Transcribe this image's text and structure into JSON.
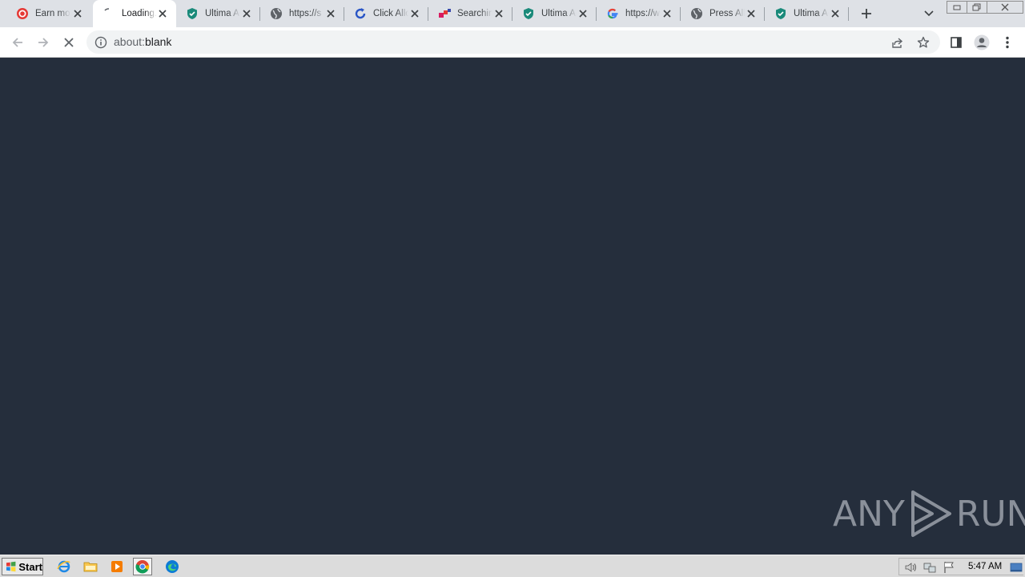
{
  "tabs": [
    {
      "title": "Earn money",
      "favicon": "red-target-icon"
    },
    {
      "title": "Loading...",
      "favicon": "loading-spinner-icon",
      "active": true
    },
    {
      "title": "Ultima Ad",
      "favicon": "shield-icon"
    },
    {
      "title": "https://s",
      "favicon": "globe-icon"
    },
    {
      "title": "Click Allow",
      "favicon": "refresh-icon"
    },
    {
      "title": "Searching",
      "favicon": "squares-icon"
    },
    {
      "title": "Ultima Ad",
      "favicon": "shield-icon"
    },
    {
      "title": "https://w",
      "favicon": "google-icon"
    },
    {
      "title": "Press Allow",
      "favicon": "globe-icon"
    },
    {
      "title": "Ultima Ad",
      "favicon": "shield-icon"
    }
  ],
  "address_bar": {
    "scheme": "about:",
    "rest": "blank"
  },
  "watermark": {
    "left": "ANY",
    "right": "RUN"
  },
  "taskbar": {
    "start_label": "Start",
    "clock": "5:47 AM"
  },
  "colors": {
    "content_bg": "#252e3c",
    "tabstrip_bg": "#dee1e6",
    "shield": "#1a8a7a"
  }
}
